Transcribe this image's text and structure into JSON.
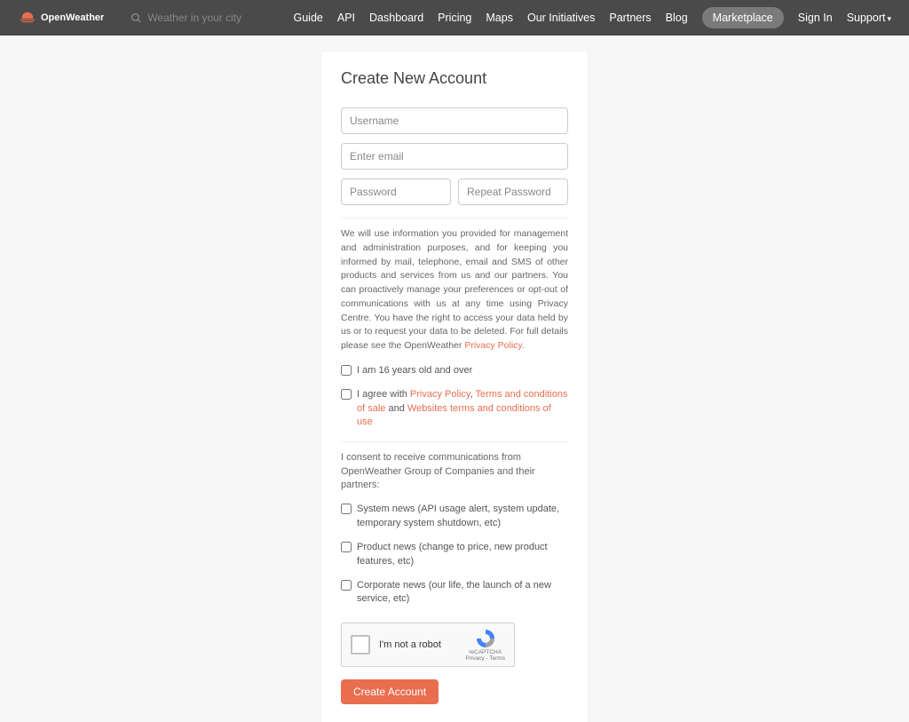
{
  "brand": {
    "name": "OpenWeather"
  },
  "search": {
    "placeholder": "Weather in your city"
  },
  "nav": {
    "guide": "Guide",
    "api": "API",
    "dashboard": "Dashboard",
    "pricing": "Pricing",
    "maps": "Maps",
    "our_initiatives": "Our Initiatives",
    "partners": "Partners",
    "blog": "Blog",
    "marketplace": "Marketplace",
    "signin": "Sign In",
    "support": "Support"
  },
  "form": {
    "title": "Create New Account",
    "username_ph": "Username",
    "email_ph": "Enter email",
    "password_ph": "Password",
    "repeat_password_ph": "Repeat Password",
    "info_text_pre": "We will use information you provided for management and administration purposes, and for keeping you informed by mail, telephone, email and SMS of other products and services from us and our partners. You can proactively manage your preferences or opt-out of communications with us at any time using Privacy Centre. You have the right to access your data held by us or to request your data to be deleted. For full details please see the OpenWeather ",
    "privacy_policy_link": "Privacy Policy",
    "info_text_post": ".",
    "age_label": "I am 16 years old and over",
    "agree_pre": "I agree with ",
    "agree_privacy": "Privacy Policy",
    "agree_comma": ", ",
    "agree_terms_sale": "Terms and conditions of sale",
    "agree_and": " and ",
    "agree_terms_use": "Websites terms and conditions of use",
    "consent_head": "I consent to receive communications from OpenWeather Group of Companies and their partners:",
    "system_news": "System news (API usage alert, system update, temporary system shutdown, etc)",
    "product_news": "Product news (change to price, new product features, etc)",
    "corporate_news": "Corporate news (our life, the launch of a new service, etc)",
    "recaptcha_label": "I'm not a robot",
    "recaptcha_brand": "reCAPTCHA",
    "recaptcha_terms": "Privacy - Terms",
    "submit": "Create Account"
  }
}
